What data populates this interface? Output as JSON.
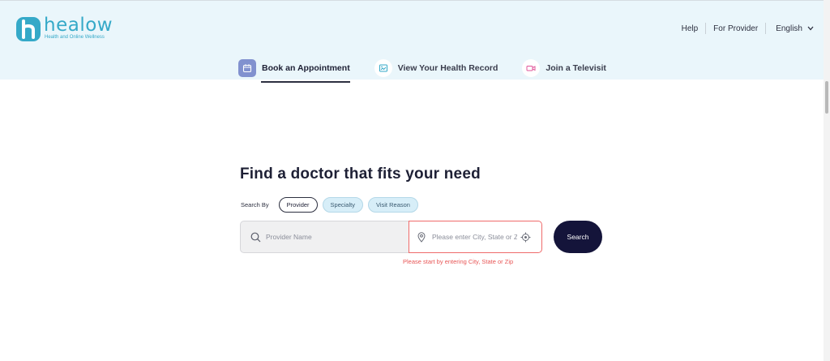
{
  "brand": {
    "logo_name": "healow",
    "tagline": "Health and Online Wellness",
    "color": "#35a9c8"
  },
  "header": {
    "help_label": "Help",
    "for_provider_label": "For Provider",
    "language_label": "English"
  },
  "tabs": [
    {
      "label": "Book an Appointment",
      "icon": "calendar-icon",
      "active": true
    },
    {
      "label": "View Your Health Record",
      "icon": "health-record-icon",
      "active": false
    },
    {
      "label": "Join a Televisit",
      "icon": "video-icon",
      "active": false
    }
  ],
  "main": {
    "headline": "Find a doctor that fits your need",
    "search_by_label": "Search By",
    "chips": [
      {
        "label": "Provider",
        "selected": true
      },
      {
        "label": "Specialty",
        "selected": false
      },
      {
        "label": "Visit Reason",
        "selected": false
      }
    ],
    "provider_placeholder": "Provider Name",
    "location_placeholder": "Please enter City, State or Zip",
    "search_label": "Search",
    "error_text": "Please start by entering City, State or Zip"
  },
  "colors": {
    "header_bg": "#eaf6fb",
    "accent": "#8191cf",
    "button_bg": "#14143a",
    "error": "#e85656"
  }
}
